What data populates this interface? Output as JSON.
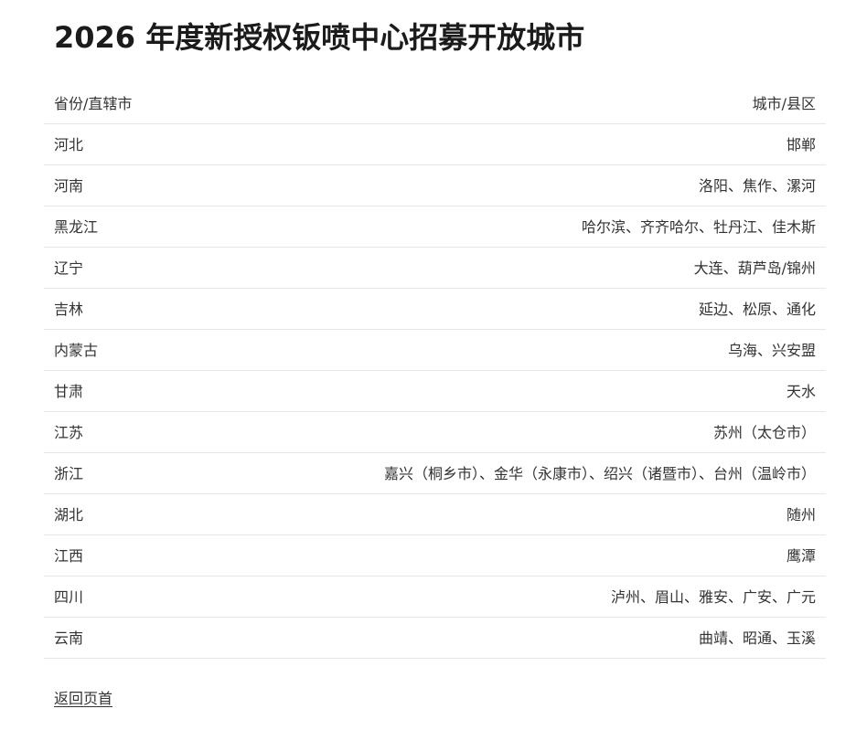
{
  "title": "2026 年度新授权钣喷中心招募开放城市",
  "table": {
    "headers": [
      "省份/直辖市",
      "城市/县区"
    ],
    "rows": [
      {
        "province": "河北",
        "cities": "邯郸"
      },
      {
        "province": "河南",
        "cities": "洛阳、焦作、漯河"
      },
      {
        "province": "黑龙江",
        "cities": "哈尔滨、齐齐哈尔、牡丹江、佳木斯"
      },
      {
        "province": "辽宁",
        "cities": "大连、葫芦岛/锦州"
      },
      {
        "province": "吉林",
        "cities": "延边、松原、通化"
      },
      {
        "province": "内蒙古",
        "cities": "乌海、兴安盟"
      },
      {
        "province": "甘肃",
        "cities": "天水"
      },
      {
        "province": "江苏",
        "cities": "苏州（太仓市）"
      },
      {
        "province": "浙江",
        "cities": "嘉兴（桐乡市）、金华（永康市）、绍兴（诸暨市）、台州（温岭市）"
      },
      {
        "province": "湖北",
        "cities": "随州"
      },
      {
        "province": "江西",
        "cities": "鹰潭"
      },
      {
        "province": "四川",
        "cities": "泸州、眉山、雅安、广安、广元"
      },
      {
        "province": "云南",
        "cities": "曲靖、昭通、玉溪"
      }
    ]
  },
  "footer": {
    "back_link": "返回页首"
  }
}
